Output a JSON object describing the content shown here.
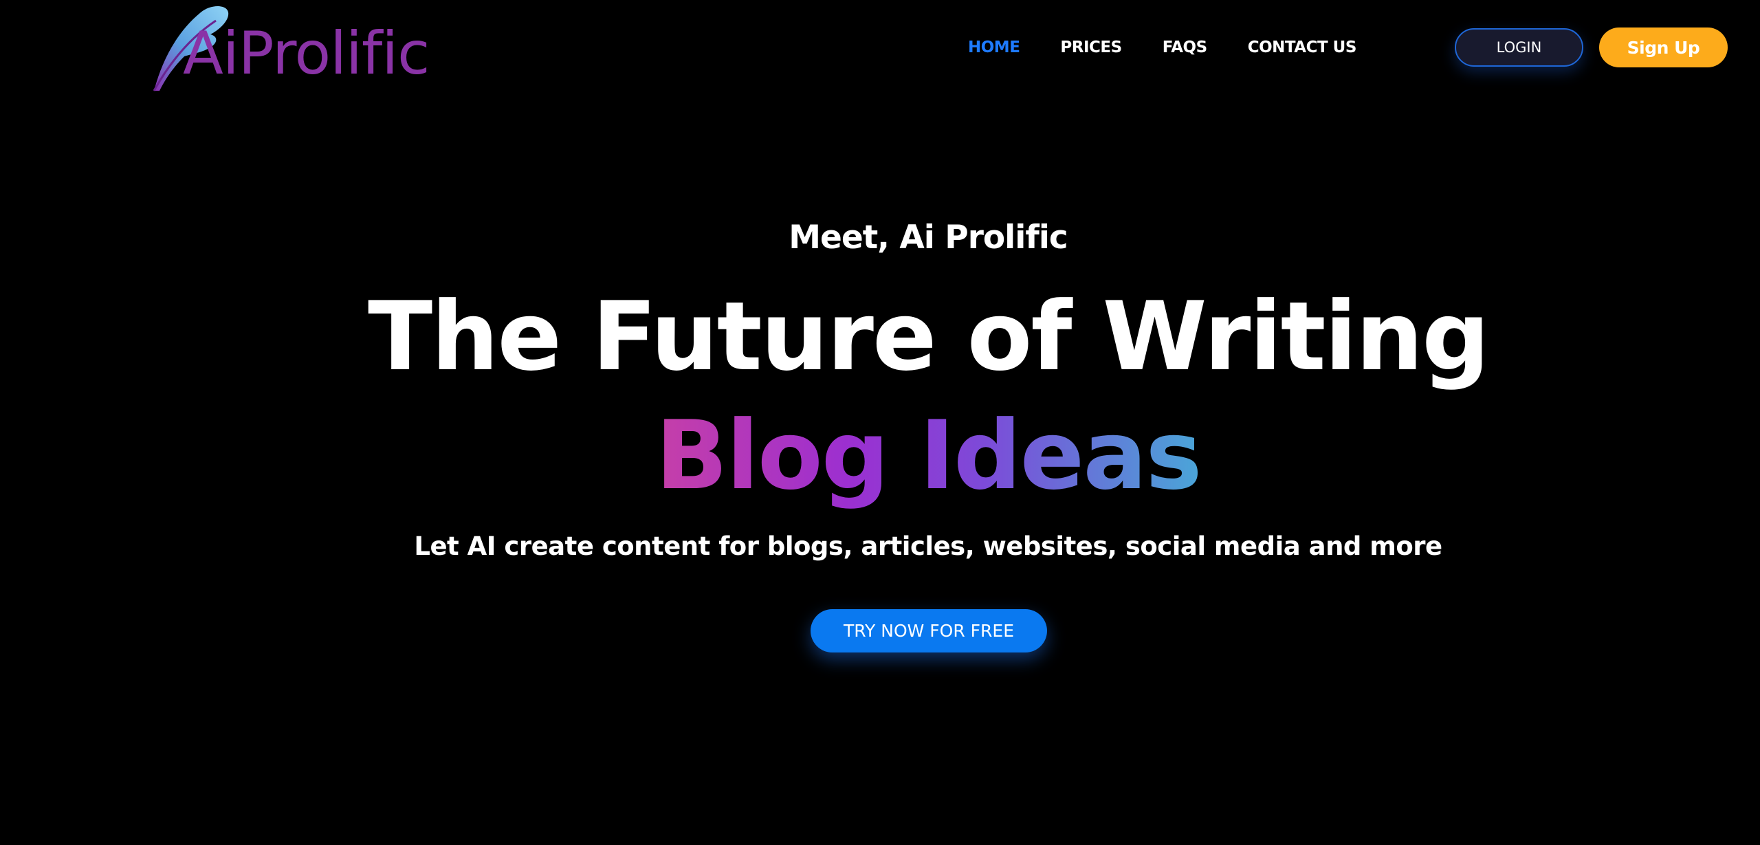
{
  "brand": {
    "logo_text": "AiProlific",
    "logo_icon": "feather-quill-icon",
    "logo_color": "#8a33a6"
  },
  "nav": {
    "items": [
      {
        "label": "HOME",
        "active": true
      },
      {
        "label": "PRICES",
        "active": false
      },
      {
        "label": "FAQS",
        "active": false
      },
      {
        "label": "CONTACT US",
        "active": false
      }
    ],
    "active_color": "#1e7bff"
  },
  "auth": {
    "login_label": "LOGIN",
    "signup_label": "Sign Up",
    "signup_color": "#fdab1b"
  },
  "hero": {
    "eyebrow": "Meet, Ai Prolific",
    "headline": "The Future of Writing",
    "rotating_text": "Blog Ideas",
    "subline": "Let AI create content for blogs, articles, websites, social media and more",
    "cta_label": "TRY NOW FOR FREE",
    "cta_color": "#0a79f0"
  },
  "colors": {
    "background": "#000000",
    "gradient": [
      "#c63fa8",
      "#9c2fd0",
      "#7d4ad8",
      "#4aa6d8"
    ]
  }
}
